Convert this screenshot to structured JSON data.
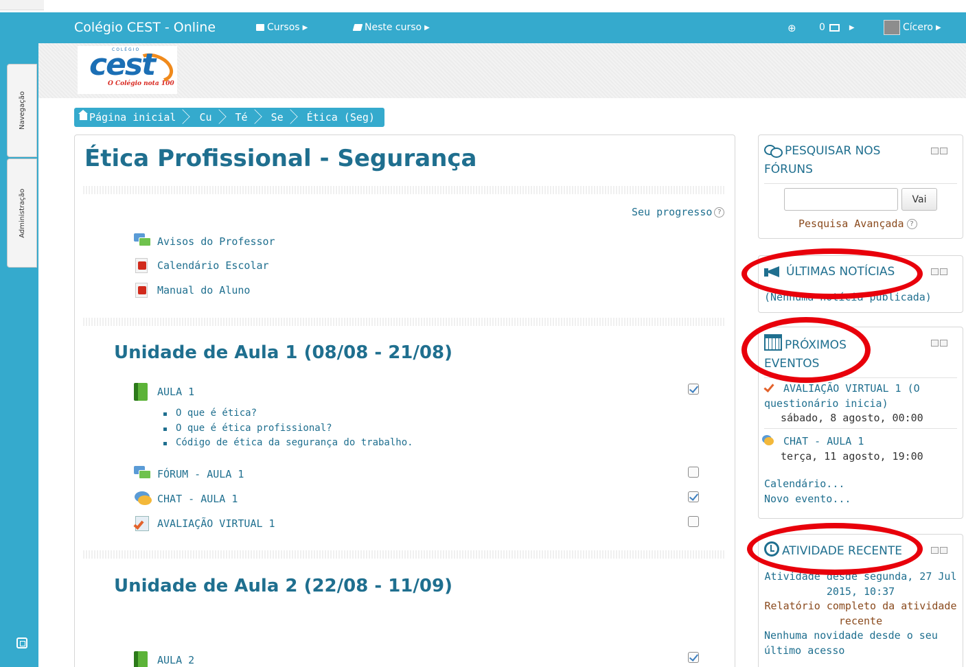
{
  "navbar": {
    "brand": "Colégio CEST - Online",
    "courses_label": "Cursos",
    "in_course_label": "Neste curso",
    "messages_count": "0",
    "user_name": "Cícero"
  },
  "dock": {
    "navigation_label": "Navegação",
    "admin_label": "Administração"
  },
  "logo": {
    "top_text": "COLÉGIO",
    "brand_text": "cest",
    "tagline": "O Colégio nota 100"
  },
  "breadcrumb": [
    {
      "label": "Página inicial"
    },
    {
      "label": "Cu"
    },
    {
      "label": "Té"
    },
    {
      "label": "Se"
    },
    {
      "label": "Ética (Seg)"
    }
  ],
  "course": {
    "title": "Ética Profissional - Segurança",
    "progress_label": "Seu progresso"
  },
  "general_section": {
    "activities": [
      {
        "label": "Avisos do Professor",
        "icon": "forum-icon"
      },
      {
        "label": "Calendário Escolar",
        "icon": "pdf-icon"
      },
      {
        "label": "Manual do Aluno",
        "icon": "pdf-icon"
      }
    ]
  },
  "unit1": {
    "title": "Unidade de Aula 1 (08/08 - 21/08)",
    "lesson": {
      "label": "AULA 1",
      "completed": true
    },
    "topics": [
      "O que é ética?",
      "O que é ética profissional?",
      "Código de ética da segurança do trabalho."
    ],
    "forum": {
      "label": "FÓRUM - AULA 1",
      "completed": false
    },
    "chat": {
      "label": "CHAT - AULA 1",
      "completed": true
    },
    "quiz": {
      "label": "AVALIAÇÃO VIRTUAL 1",
      "completed": false
    }
  },
  "unit2": {
    "title": "Unidade de Aula 2 (22/08 - 11/09)",
    "lesson": {
      "label": "AULA 2",
      "completed": true
    }
  },
  "blocks": {
    "search": {
      "title_line1": "PESQUISAR NOS",
      "title_line2": "FÓRUNS",
      "button": "Vai",
      "input_value": "",
      "advanced": "Pesquisa Avançada"
    },
    "news": {
      "title": "ÚLTIMAS NOTÍCIAS",
      "empty": "(Nenhuma notícia publicada)"
    },
    "events": {
      "title_line1": "PRÓXIMOS",
      "title_line2": "EVENTOS",
      "items": [
        {
          "line1": "AVALIAÇÃO VIRTUAL 1 (O",
          "line2": "questionário inicia)",
          "date": "sábado, 8 agosto, 00:00"
        },
        {
          "line1": "CHAT - AULA 1",
          "date": "terça, 11 agosto, 19:00"
        }
      ],
      "calendar_link": "Calendário...",
      "new_event_link": "Novo evento..."
    },
    "recent": {
      "title": "ATIVIDADE RECENTE",
      "since_line1": "Atividade desde segunda, 27 Jul",
      "since_line2": "2015, 10:37",
      "report_line1": "Relatório completo da atividade",
      "report_line2": "recente",
      "none_line1": "Nenhuma novidade desde o seu",
      "none_line2": "último acesso"
    }
  },
  "colors": {
    "navbar": "#35aacd",
    "link": "#1f6f8f",
    "annotation_ring": "#e8000b"
  }
}
